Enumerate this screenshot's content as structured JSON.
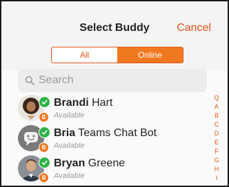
{
  "header": {
    "title": "Select Buddy",
    "cancel_label": "Cancel"
  },
  "segments": [
    {
      "label": "All",
      "active": false
    },
    {
      "label": "Online",
      "active": true
    }
  ],
  "search": {
    "placeholder": "Search"
  },
  "buddies": [
    {
      "first": "Brandi",
      "last": " Hart",
      "status": "Available",
      "badge": "B",
      "avatar": "person-avatar"
    },
    {
      "first": "Bria",
      "last": " Teams Chat Bot",
      "status": "Available",
      "badge": "B",
      "avatar": "bot-avatar"
    },
    {
      "first": "Bryan",
      "last": " Greene",
      "status": "Available",
      "badge": "B",
      "avatar": "person-avatar"
    }
  ],
  "index_letters": [
    "Q",
    "A",
    "B",
    "C",
    "D",
    "E",
    "F",
    "G",
    "H",
    "I"
  ],
  "colors": {
    "accent": "#e2541b",
    "segment_active": "#f07920",
    "online": "#2fb34a"
  }
}
